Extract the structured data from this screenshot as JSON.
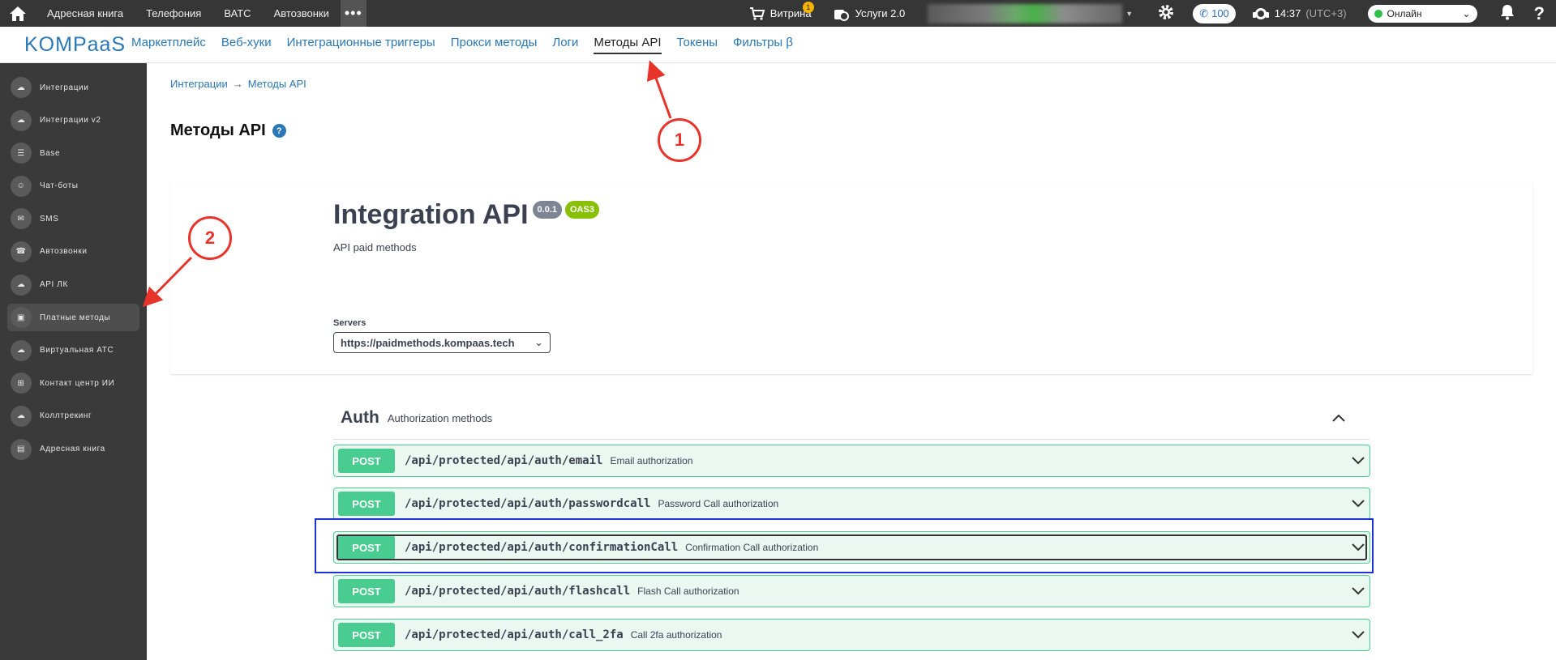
{
  "topbar": {
    "home_icon": "home-icon",
    "nav": [
      "Адресная книга",
      "Телефония",
      "ВАТС",
      "Автозвонки"
    ],
    "more": "•••",
    "shop_label": "Витрина",
    "shop_badge": "1",
    "services_label": "Услуги 2.0",
    "phone_count": "100",
    "time": "14:37",
    "timezone": "(UTC+3)",
    "status": "Онлайн"
  },
  "subnav": {
    "logo": "KOMPaaS",
    "tabs": [
      "Маркетплейс",
      "Веб-хуки",
      "Интеграционные триггеры",
      "Прокси методы",
      "Логи",
      "Методы API",
      "Токены",
      "Фильтры β"
    ],
    "active_tab": "Методы API"
  },
  "sidebar": {
    "items": [
      {
        "label": "Интеграции",
        "icon": "cloud-sync-icon"
      },
      {
        "label": "Интеграции v2",
        "icon": "cloud-sync-icon"
      },
      {
        "label": "Base",
        "icon": "list-icon"
      },
      {
        "label": "Чат-боты",
        "icon": "chatbot-icon"
      },
      {
        "label": "SMS",
        "icon": "sms-icon"
      },
      {
        "label": "Автозвонки",
        "icon": "robot-call-icon"
      },
      {
        "label": "API ЛК",
        "icon": "api-cloud-icon"
      },
      {
        "label": "Платные методы",
        "icon": "wallet-icon"
      },
      {
        "label": "Виртуальная АТС",
        "icon": "cloud-phone-icon"
      },
      {
        "label": "Контакт центр ИИ",
        "icon": "network-icon"
      },
      {
        "label": "Коллтрекинг",
        "icon": "cloud-track-icon"
      },
      {
        "label": "Адресная книга",
        "icon": "address-book-icon"
      }
    ],
    "active": "Платные методы"
  },
  "breadcrumb": {
    "root": "Интеграции",
    "sep": "→",
    "current": "Методы API"
  },
  "page_title": "Методы API",
  "help_mark": "?",
  "api": {
    "title": "Integration API",
    "version": "0.0.1",
    "oas": "OAS3",
    "description": "API paid methods"
  },
  "servers": {
    "label": "Servers",
    "selected": "https://paidmethods.kompaas.tech"
  },
  "auth_group": {
    "name": "Auth",
    "description": "Authorization methods"
  },
  "operations": [
    {
      "method": "POST",
      "path": "/api/protected/api/auth/email",
      "summary": "Email authorization"
    },
    {
      "method": "POST",
      "path": "/api/protected/api/auth/passwordcall",
      "summary": "Password Call authorization"
    },
    {
      "method": "POST",
      "path": "/api/protected/api/auth/confirmationCall",
      "summary": "Confirmation Call authorization"
    },
    {
      "method": "POST",
      "path": "/api/protected/api/auth/flashcall",
      "summary": "Flash Call authorization"
    },
    {
      "method": "POST",
      "path": "/api/protected/api/auth/call_2fa",
      "summary": "Call 2fa authorization"
    }
  ],
  "annotations": {
    "one": "1",
    "two": "2"
  },
  "colors": {
    "topbar": "#363636",
    "sidebar": "#3a3a3a",
    "post": "#49cc90",
    "accent": "#2a78b5",
    "annotation": "#e8332a",
    "highlight": "#1d33d8"
  }
}
